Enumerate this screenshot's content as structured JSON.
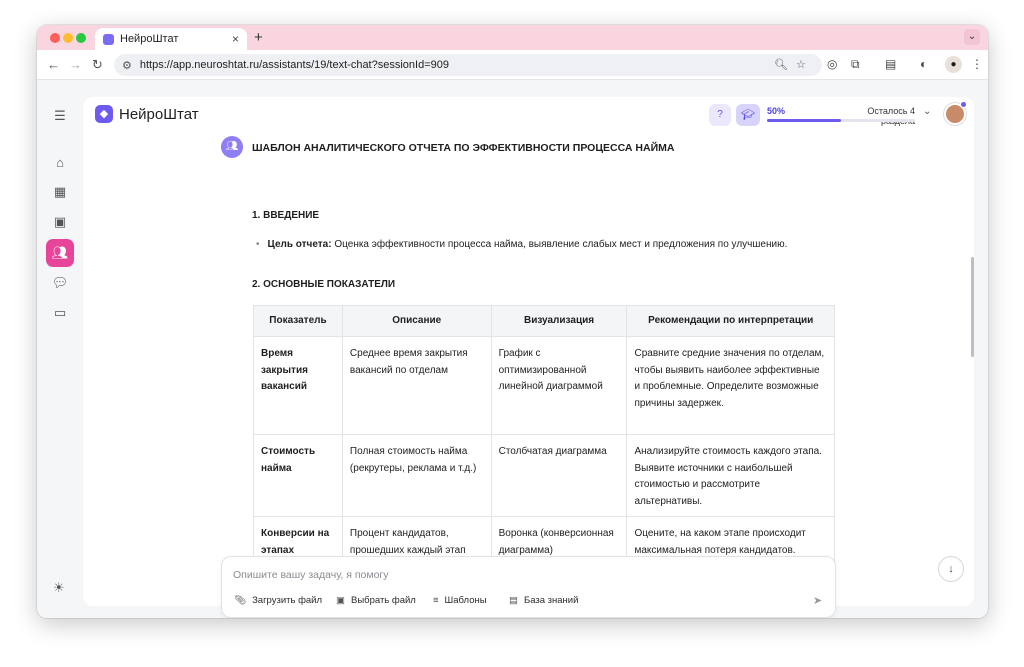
{
  "browser": {
    "tab_title": "НейроШтат",
    "tab_close": "×",
    "new_tab": "+",
    "url": "https://app.neuroshtat.ru/assistants/19/text-chat?sessionId=909"
  },
  "app": {
    "brand": "НейроШтат",
    "progress": {
      "percent_label": "50%",
      "percent_value": 50,
      "remaining": "Осталось 4 раздела"
    }
  },
  "report": {
    "title": "ШАБЛОН АНАЛИТИЧЕСКОГО ОТЧЕТА ПО ЭФФЕКТИВНОСТИ ПРОЦЕССА НАЙМА",
    "sections": [
      {
        "heading": "1. ВВЕДЕНИЕ",
        "bullet_label": "Цель отчета:",
        "bullet_text": "Оценка эффективности процесса найма, выявление слабых мест и предложения по улучшению."
      },
      {
        "heading": "2. ОСНОВНЫЕ ПОКАЗАТЕЛИ"
      }
    ],
    "table": {
      "headers": [
        "Показатель",
        "Описание",
        "Визуализация",
        "Рекомендации по интерпретации"
      ],
      "rows": [
        [
          "Время закрытия вакансий",
          "Среднее время закрытия вакансий по отделам",
          "График с оптимизированной линейной диаграммой",
          "Сравните средние значения по отделам, чтобы выявить наиболее эффективные и проблемные. Определите возможные причины задержек."
        ],
        [
          "Стоимость найма",
          "Полная стоимость найма (рекрутеры, реклама и т.д.)",
          "Столбчатая диаграмма",
          "Анализируйте стоимость каждого этапа. Выявите источники с наибольшей стоимостью и рассмотрите альтернативы."
        ],
        [
          "Конверсии на этапах",
          "Процент кандидатов, прошедших каждый этап",
          "Воронка (конверсионная диаграмма)",
          "Оцените, на каком этапе происходит максимальная потеря кандидатов."
        ]
      ]
    }
  },
  "composer": {
    "placeholder": "Опишите вашу задачу, я помогу",
    "actions": [
      "Загрузить файл",
      "Выбрать файл",
      "Шаблоны",
      "База знаний"
    ]
  },
  "colors": {
    "accent": "#6d5bf0",
    "active_nav": "#e6459a",
    "tabbar": "#f9d5e0"
  }
}
